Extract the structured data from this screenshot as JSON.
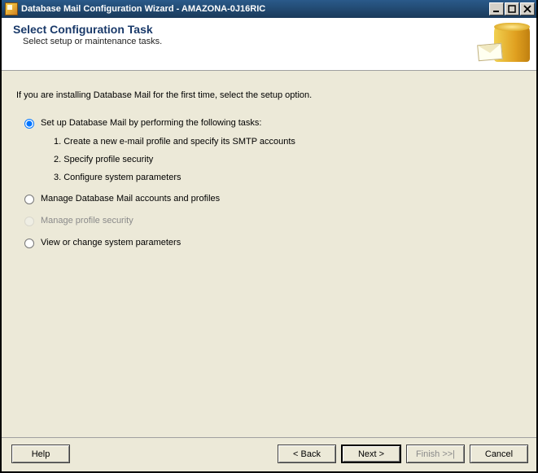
{
  "window": {
    "title": "Database Mail Configuration Wizard - AMAZONA-0J16RIC"
  },
  "header": {
    "title": "Select Configuration Task",
    "subtitle": "Select setup or maintenance tasks."
  },
  "content": {
    "intro": "If you are installing Database Mail for the first time, select the setup option."
  },
  "options": {
    "setup": {
      "label": "Set up Database Mail by performing the following tasks:",
      "steps": {
        "step1": "1. Create a new e-mail profile and specify its SMTP accounts",
        "step2": "2. Specify profile security",
        "step3": "3. Configure system parameters"
      }
    },
    "manage_accounts": "Manage Database Mail accounts and profiles",
    "manage_security": "Manage profile security",
    "view_params": "View or change system parameters"
  },
  "footer": {
    "help": "Help",
    "back": "< Back",
    "next": "Next >",
    "finish": "Finish >>|",
    "cancel": "Cancel"
  }
}
